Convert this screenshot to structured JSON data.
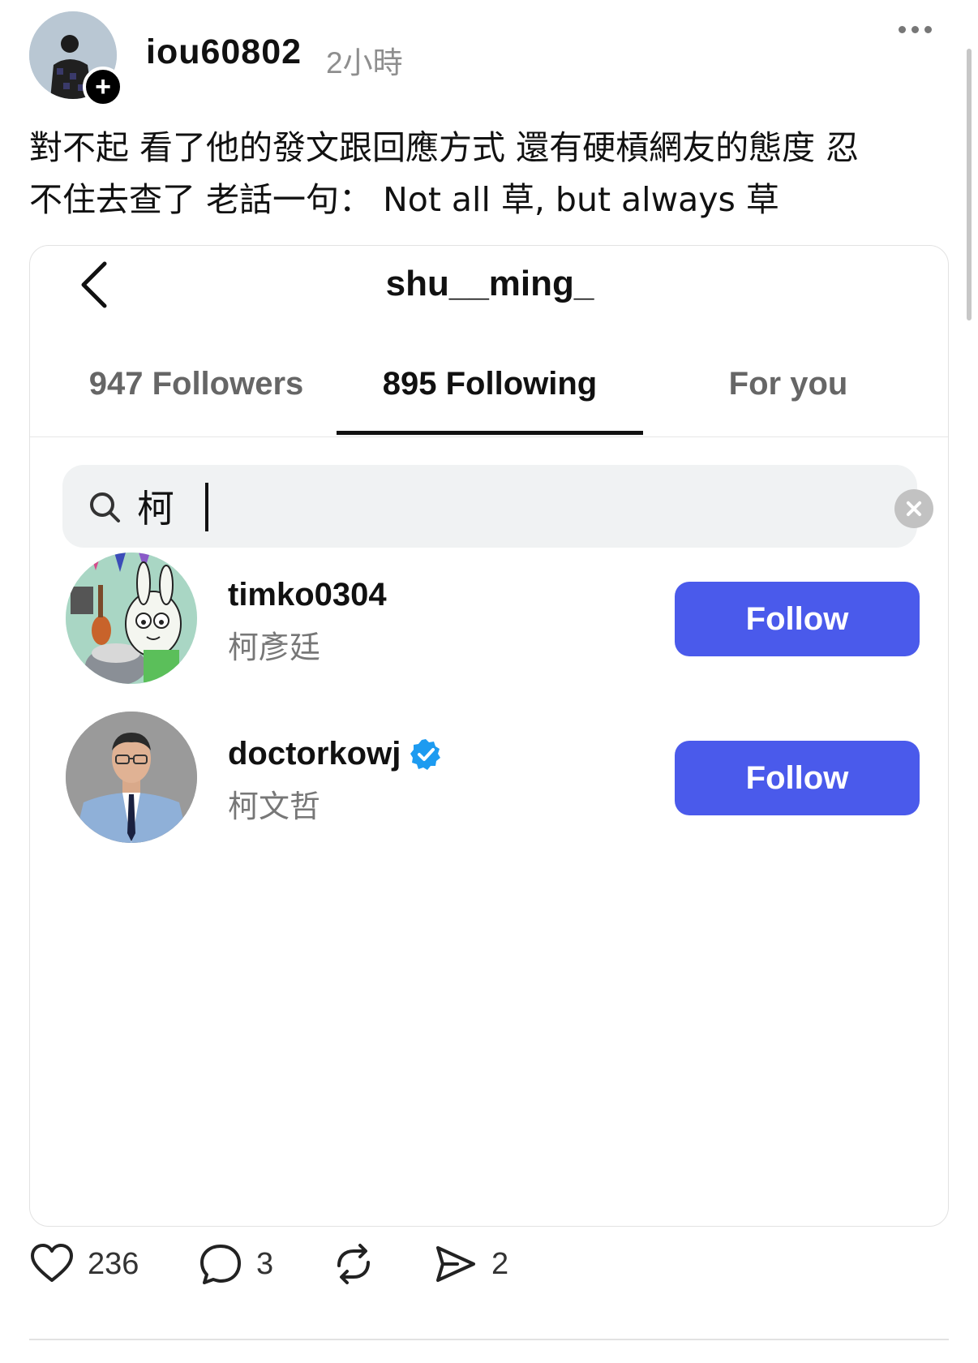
{
  "post": {
    "author": "iou60802",
    "time": "2小時",
    "text_line1": "對不起 看了他的發文跟回應方式 還有硬槓網友的態度 忍",
    "text_line2": "不住去查了 老話一句： Not all 草, but always 草"
  },
  "embed": {
    "profile_name": "shu__ming_",
    "tabs": [
      {
        "label": "947 Followers",
        "active": false
      },
      {
        "label": "895 Following",
        "active": true
      },
      {
        "label": "For you",
        "active": false
      }
    ],
    "search": {
      "value": "柯",
      "placeholder": ""
    },
    "users": [
      {
        "handle": "timko0304",
        "full_name": "柯彥廷",
        "verified": false,
        "button": "Follow"
      },
      {
        "handle": "doctorkowj",
        "full_name": "柯文哲",
        "verified": true,
        "button": "Follow"
      }
    ]
  },
  "actions": {
    "likes": "236",
    "comments": "3",
    "shares": "2"
  },
  "colors": {
    "follow_button": "#4a5aeb",
    "verified": "#1d9bf0",
    "text": "#111111",
    "muted": "#8e8e8e"
  }
}
